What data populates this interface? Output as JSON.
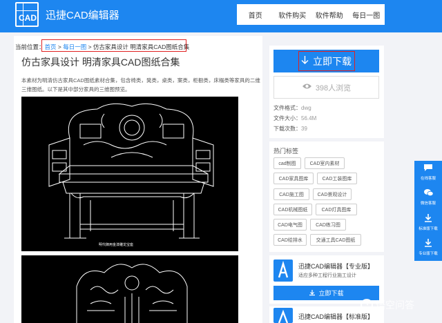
{
  "header": {
    "logo_text": "CAD",
    "brand": "迅捷CAD编辑器",
    "nav": [
      "首页",
      "软件购买",
      "软件帮助",
      "每日一图"
    ]
  },
  "breadcrumb": {
    "prefix": "当前位置：",
    "home": "首页",
    "sep": " > ",
    "daily": "每日一图",
    "current": "仿古家具设计 明清家具CAD图纸合集"
  },
  "article": {
    "title": "仿古家具设计 明清家具CAD图纸合集",
    "desc": "本素材为明清仿古家具CAD图纸素材合集，包含椅类，凳类，桌类，案类，柜橱类，床榻类等家具的二维三维图纸。以下是其中部分家具的三维图预览。",
    "image_caption": "明代御用金漆雕龙宝座"
  },
  "download": {
    "button_label": "立即下载",
    "views_label": "398人浏览",
    "format_label": "文件格式：",
    "format_value": "dwg",
    "size_label": "文件大小：",
    "size_value": "56.4M",
    "count_label": "下载次数：",
    "count_value": "39"
  },
  "tags": {
    "title": "热门标签",
    "items": [
      "cad制图",
      "CAD室内素材",
      "CAD家具图库",
      "CAD工装图库",
      "CAD施工图",
      "CAD景观设计",
      "CAD机械图纸",
      "CAD灯具图库",
      "CAD电气图",
      "CAD练习图",
      "CAD绘排水",
      "交通工具CAD图纸"
    ]
  },
  "product": {
    "title": "迅捷CAD编辑器【专业版】",
    "subtitle": "适应多种工程行业施工设计",
    "button_label": "立即下载",
    "second_title": "迅捷CAD编辑器【标准版】"
  },
  "float_bar": {
    "items": [
      "在线客服",
      "微信客服",
      "标准版下载",
      "专业版下载"
    ]
  },
  "watermark": {
    "text": "悟空问答"
  }
}
